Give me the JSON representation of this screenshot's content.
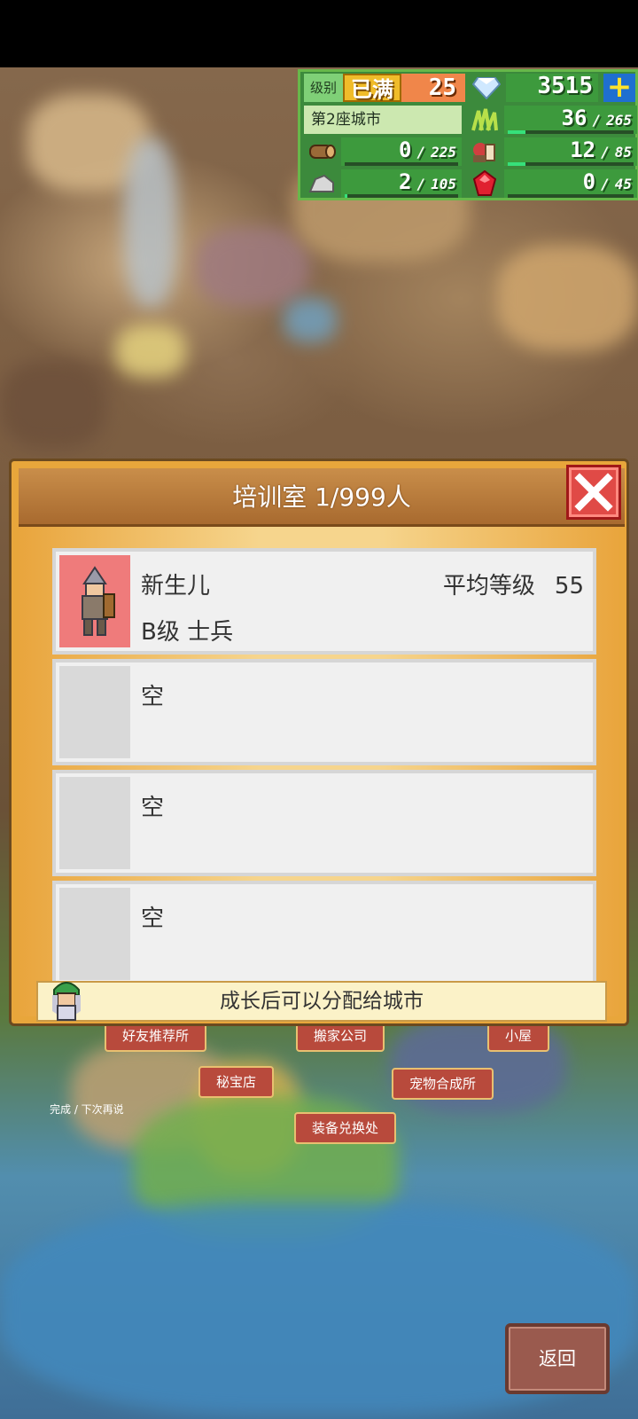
{
  "hud": {
    "level_label": "级别",
    "level_max": "已满",
    "level": "25",
    "gems": "3515",
    "city": "第2座城市",
    "resources": [
      {
        "icon": "grass-icon",
        "value": "36",
        "cap": "265",
        "fill": 0.14
      },
      {
        "icon": "wood-icon",
        "value": "0",
        "cap": "225",
        "fill": 0
      },
      {
        "icon": "food-icon",
        "value": "12",
        "cap": "85",
        "fill": 0.14
      },
      {
        "icon": "ore-icon",
        "value": "2",
        "cap": "105",
        "fill": 0.02
      },
      {
        "icon": "ruby-icon",
        "value": "0",
        "cap": "45",
        "fill": 0
      }
    ]
  },
  "modal": {
    "title": "培训室 1/999人",
    "slots": [
      {
        "name": "新生儿",
        "rank": "B级 士兵",
        "avg_label": "平均等级",
        "avg_value": "55"
      },
      {
        "name": "空"
      },
      {
        "name": "空"
      },
      {
        "name": "空"
      }
    ],
    "footer": "成长后可以分配给城市"
  },
  "map": {
    "labels": [
      "好友推荐所",
      "搬家公司",
      "小屋",
      "秘宝店",
      "宠物合成所",
      "装备兑换处"
    ],
    "hint": "完成 / 下次再说"
  },
  "back": "返回",
  "colors": {
    "accent": "#e8a63b",
    "hud": "#3c8a3c",
    "close": "#e04a46"
  }
}
